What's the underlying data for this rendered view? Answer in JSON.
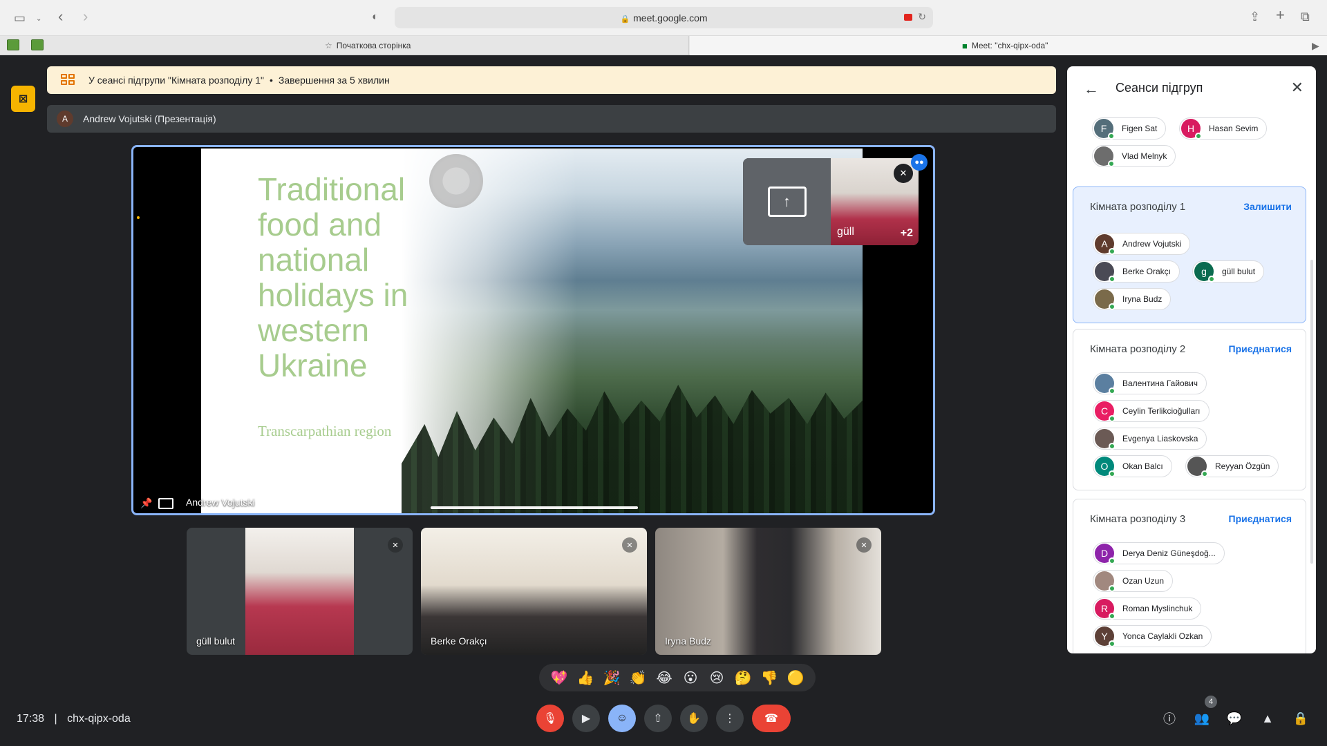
{
  "browser": {
    "url": "meet.google.com",
    "tabs": [
      "Початкова сторінка",
      "Meet: \"chx-qipx-oda\""
    ]
  },
  "banner": {
    "text": "У сеансі підгрупи \"Кімната розподілу 1\"",
    "separator": "•",
    "ending": "Завершення за 5 хвилин"
  },
  "presenter_bar": {
    "avatar_letter": "A",
    "text": "Andrew Vojutski (Презентація)"
  },
  "slide": {
    "title": "Traditional food and national holidays in western Ukraine",
    "subtitle": "Transcarpathian region"
  },
  "stage": {
    "presenter_name": "Andrew Vojutski"
  },
  "self_tile": {
    "name": "güll",
    "extra_count": "+2"
  },
  "tiles": [
    {
      "name": "güll bulut"
    },
    {
      "name": "Berke Orakçı"
    },
    {
      "name": "Iryna Budz"
    }
  ],
  "reactions": [
    "💖",
    "👍",
    "🎉",
    "👏",
    "😂",
    "😮",
    "😢",
    "🤔",
    "👎",
    "🟡"
  ],
  "bottom": {
    "time": "17:38",
    "separator": "|",
    "meeting_code": "chx-qipx-oda",
    "people_count": "4"
  },
  "panel": {
    "title": "Сеанси підгруп",
    "top_people": [
      {
        "name": "Figen Sat",
        "letter": "F",
        "color": "#546e7a"
      },
      {
        "name": "Hasan Sevim",
        "letter": "H",
        "color": "#d81b60"
      },
      {
        "name": "Vlad Melnyk",
        "letter": "",
        "color": "#6d6d6d"
      }
    ],
    "rooms": [
      {
        "title": "Кімната розподілу 1",
        "action": "Залишити",
        "people": [
          {
            "name": "Andrew Vojutski",
            "letter": "A",
            "color": "#5f3b2d"
          },
          {
            "name": "Berke Orakçı",
            "letter": "",
            "color": "#4a4a55"
          },
          {
            "name": "güll bulut",
            "letter": "g",
            "color": "#0b6b4f"
          },
          {
            "name": "Iryna Budz",
            "letter": "",
            "color": "#7a6a4a"
          }
        ]
      },
      {
        "title": "Кімната розподілу 2",
        "action": "Приєднатися",
        "people": [
          {
            "name": "Валентина Гайович",
            "letter": "",
            "color": "#5b7fa0"
          },
          {
            "name": "Ceylin Terlikcioğulları",
            "letter": "C",
            "color": "#e91e63"
          },
          {
            "name": "Evgenya Liaskovska",
            "letter": "",
            "color": "#6b5a55"
          },
          {
            "name": "Okan Balcı",
            "letter": "O",
            "color": "#00897b"
          },
          {
            "name": "Reyyan Özgün",
            "letter": "",
            "color": "#555"
          }
        ]
      },
      {
        "title": "Кімната розподілу 3",
        "action": "Приєднатися",
        "people": [
          {
            "name": "Derya Deniz Güneşdoğ...",
            "letter": "D",
            "color": "#8e24aa"
          },
          {
            "name": "Ozan Uzun",
            "letter": "",
            "color": "#a1887f"
          },
          {
            "name": "Roman Myslinchuk",
            "letter": "R",
            "color": "#d81b60"
          },
          {
            "name": "Yonca Caylakli Ozkan",
            "letter": "Y",
            "color": "#5d4037"
          }
        ]
      }
    ]
  }
}
